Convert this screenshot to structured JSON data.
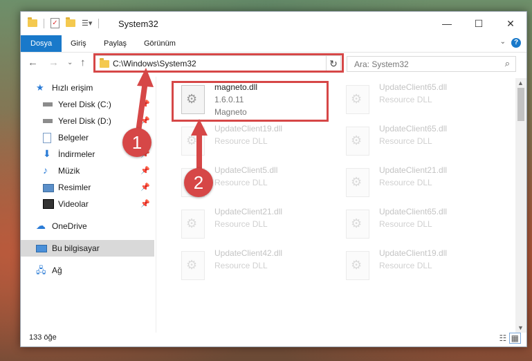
{
  "window": {
    "title": "System32"
  },
  "ribbon": {
    "tabs": [
      "Dosya",
      "Giriş",
      "Paylaş",
      "Görünüm"
    ],
    "help": "?"
  },
  "nav": {
    "path": "C:\\Windows\\System32",
    "search_placeholder": "Ara: System32"
  },
  "sidebar": {
    "items": [
      {
        "label": "Hızlı erişim",
        "icon": "star-icon",
        "pinned": false
      },
      {
        "label": "Yerel Disk (C:)",
        "icon": "drive-icon",
        "pinned": true
      },
      {
        "label": "Yerel Disk (D:)",
        "icon": "drive-icon",
        "pinned": true
      },
      {
        "label": "Belgeler",
        "icon": "document-icon",
        "pinned": true
      },
      {
        "label": "İndirmeler",
        "icon": "download-icon",
        "pinned": true
      },
      {
        "label": "Müzik",
        "icon": "music-icon",
        "pinned": true
      },
      {
        "label": "Resimler",
        "icon": "pictures-icon",
        "pinned": true
      },
      {
        "label": "Videolar",
        "icon": "video-icon",
        "pinned": true
      },
      {
        "label": "OneDrive",
        "icon": "cloud-icon",
        "pinned": false
      },
      {
        "label": "Bu bilgisayar",
        "icon": "computer-icon",
        "pinned": false,
        "selected": true
      },
      {
        "label": "Ağ",
        "icon": "network-icon",
        "pinned": false
      }
    ]
  },
  "files": [
    {
      "name": "magneto.dll",
      "version": "1.6.0.11",
      "desc": "Magneto"
    },
    {
      "name": "UpdateClient65.dll",
      "version": "",
      "desc": "Resource DLL"
    },
    {
      "name": "UpdateClient19.dll",
      "version": "",
      "desc": "Resource DLL"
    },
    {
      "name": "UpdateClient65.dll",
      "version": "",
      "desc": "Resource DLL"
    },
    {
      "name": "UpdateClient5.dll",
      "version": "",
      "desc": "Resource DLL"
    },
    {
      "name": "UpdateClient21.dll",
      "version": "",
      "desc": "Resource DLL"
    },
    {
      "name": "UpdateClient21.dll",
      "version": "",
      "desc": "Resource DLL"
    },
    {
      "name": "UpdateClient65.dll",
      "version": "",
      "desc": "Resource DLL"
    },
    {
      "name": "UpdateClient42.dll",
      "version": "",
      "desc": "Resource DLL"
    },
    {
      "name": "UpdateClient19.dll",
      "version": "",
      "desc": "Resource DLL"
    }
  ],
  "status": {
    "count": "133 öğe"
  },
  "callouts": [
    "1",
    "2"
  ],
  "colors": {
    "accent": "#1979ca",
    "highlight": "#d64747"
  }
}
